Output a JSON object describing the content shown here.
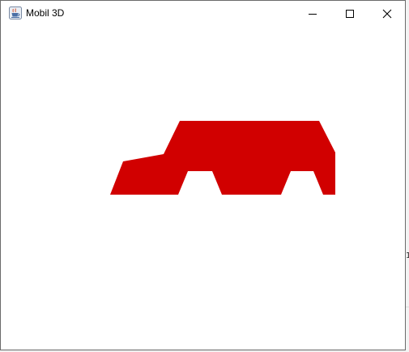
{
  "window": {
    "title": "Mobil 3D",
    "icon": "java-cup-icon",
    "controls": {
      "minimize_icon": "minimize-icon",
      "maximize_icon": "maximize-icon",
      "close_icon": "close-icon"
    }
  },
  "canvas": {
    "background": "#ffffff",
    "car_color": "#d10000",
    "shape": "car-silhouette"
  },
  "background_app": {
    "glyph": "1"
  }
}
